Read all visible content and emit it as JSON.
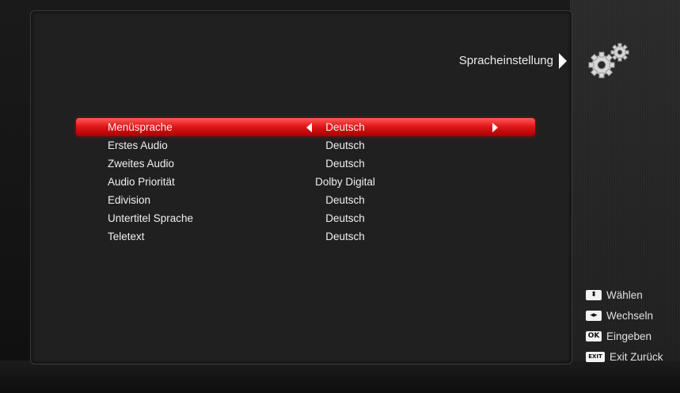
{
  "header": {
    "title": "Spracheinstellung"
  },
  "menu": {
    "items": [
      {
        "label": "Menüsprache",
        "value": "Deutsch"
      },
      {
        "label": "Erstes Audio",
        "value": "Deutsch"
      },
      {
        "label": "Zweites Audio",
        "value": "Deutsch"
      },
      {
        "label": "Audio Priorität",
        "value": "Dolby Digital"
      },
      {
        "label": "Edivision",
        "value": "Deutsch"
      },
      {
        "label": "Untertitel Sprache",
        "value": "Deutsch"
      },
      {
        "label": "Teletext",
        "value": "Deutsch"
      }
    ]
  },
  "help": {
    "items": [
      {
        "key": "⬍",
        "icon": "up-down-key-icon",
        "label": "Wählen"
      },
      {
        "key": "◂▸",
        "icon": "left-right-key-icon",
        "label": "Wechseln"
      },
      {
        "key": "OK",
        "icon": "ok-key-icon",
        "label": "Eingeben"
      },
      {
        "key": "EXIT",
        "icon": "exit-key-icon",
        "label": "Exit Zurück"
      }
    ]
  },
  "colors": {
    "selected_row": "#e01818",
    "background": "#202020",
    "text": "#f0f0f0"
  }
}
